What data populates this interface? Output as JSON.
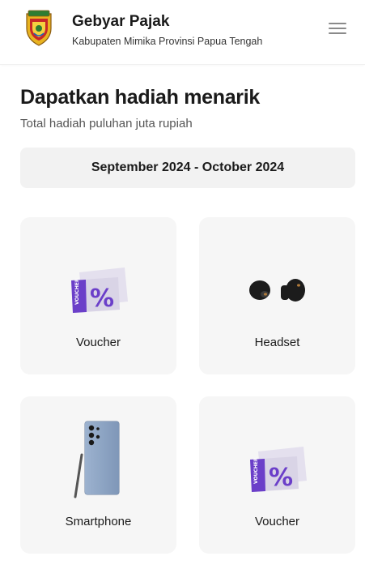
{
  "header": {
    "title": "Gebyar Pajak",
    "subtitle": "Kabupaten Mimika Provinsi Papua Tengah",
    "logo_icon": "regency-crest-logo",
    "menu_icon": "hamburger-menu-icon"
  },
  "main": {
    "title": "Dapatkan hadiah menarik",
    "subtitle": "Total hadiah puluhan juta rupiah",
    "period": "September 2024 - October 2024"
  },
  "prizes": [
    {
      "label": "Voucher",
      "icon": "voucher-icon"
    },
    {
      "label": "Headset",
      "icon": "earbuds-icon"
    },
    {
      "label": "Smartphone",
      "icon": "smartphone-icon"
    },
    {
      "label": "Voucher",
      "icon": "voucher-icon"
    }
  ],
  "colors": {
    "voucher_purple": "#6b3fc9",
    "card_bg": "#f6f6f6",
    "period_bg": "#f2f2f2"
  }
}
